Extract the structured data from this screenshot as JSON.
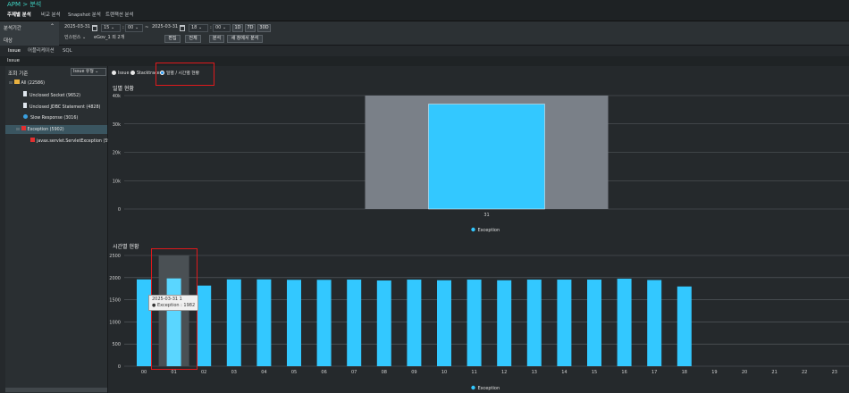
{
  "app": {
    "title": "APM > 분석"
  },
  "nav": {
    "items": [
      "주제별 분석",
      "비교 분석",
      "Snapshot 분석",
      "트랜잭션 분석"
    ]
  },
  "filter": {
    "period_label": "분석기간",
    "target_label": "대상",
    "start_date": "2025-03-31",
    "start_hour": "15",
    "start_min": "00",
    "end_date": "2025-03-31",
    "end_hour": "18",
    "end_min": "00",
    "quick_buttons": [
      "1D",
      "7D",
      "30D"
    ],
    "instance_label": "인스턴스",
    "instance_value": "eGov_1 외 2개",
    "edit_label": "편집",
    "all_label": "전체",
    "analyze_label": "분석",
    "new_window_label": "새 창에서 분석",
    "tilde": "~",
    "colon": ":"
  },
  "subtabs": [
    "Issue",
    "어플리케이션",
    "SQL"
  ],
  "issue_bar": "Issue",
  "sidebar": {
    "title": "조회 기준",
    "select_value": "Issue 유형",
    "tree": [
      "All (22586)",
      "Unclosed Socket (9652)",
      "Unclosed JDBC Statement (4828)",
      "Slow Response (3016)",
      "Exception (5902)",
      "javax.servlet.ServletException (590"
    ]
  },
  "view": {
    "options": [
      "Issue",
      "Stacktrace",
      "일별 / 시간별 현황"
    ],
    "selected": "일별 / 시간별 현황"
  },
  "daily": {
    "title": "일별 현황"
  },
  "hourly": {
    "title": "시간별 현황"
  },
  "tooltip": {
    "line1": "2025-03-31 1",
    "line2": "● Exception : 1982"
  },
  "colors": {
    "bar": "#33c8ff",
    "highlight": "#7a8088",
    "red": "#e0191c"
  },
  "chart_data": [
    {
      "type": "bar",
      "title": "일별 현황",
      "categories": [
        "31"
      ],
      "series": [
        {
          "name": "Exception",
          "values": [
            37000
          ]
        }
      ],
      "yticks": [
        "40k",
        "30k",
        "20k",
        "10k",
        "0"
      ],
      "ylim": [
        0,
        40000
      ],
      "grid": true,
      "legend": "bottom"
    },
    {
      "type": "bar",
      "title": "시간별 현황",
      "categories": [
        "00",
        "01",
        "02",
        "03",
        "04",
        "05",
        "06",
        "07",
        "08",
        "09",
        "10",
        "11",
        "12",
        "13",
        "14",
        "15",
        "16",
        "17",
        "18",
        "19",
        "20",
        "21",
        "22",
        "23"
      ],
      "series": [
        {
          "name": "Exception",
          "values": [
            1960,
            1982,
            1820,
            1960,
            1960,
            1950,
            1950,
            1955,
            1935,
            1955,
            1940,
            1955,
            1940,
            1955,
            1955,
            1955,
            1975,
            1945,
            1800,
            0,
            0,
            0,
            0,
            0
          ]
        }
      ],
      "yticks": [
        "2500",
        "2000",
        "1500",
        "1000",
        "500",
        "0"
      ],
      "ylim": [
        0,
        2500
      ],
      "grid": true,
      "legend": "bottom"
    }
  ]
}
